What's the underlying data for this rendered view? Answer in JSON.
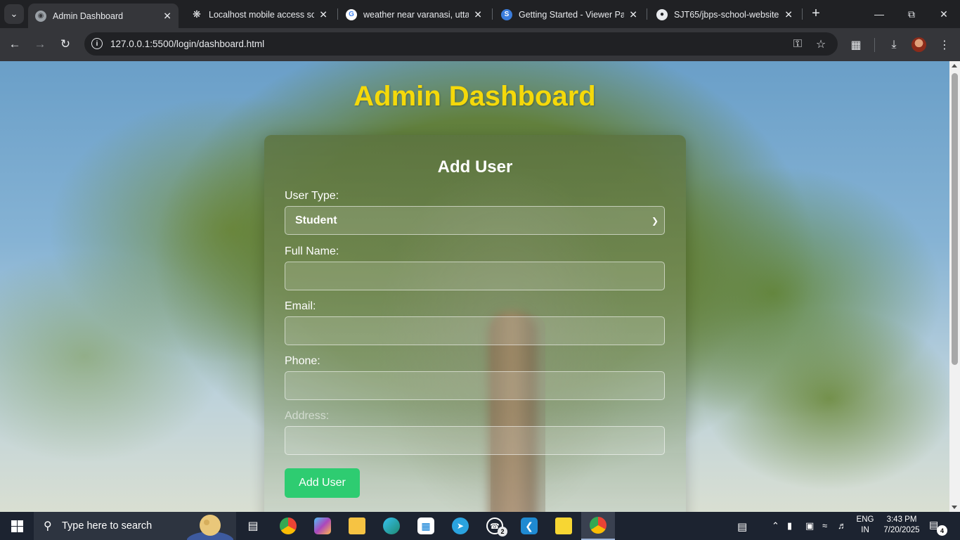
{
  "browser": {
    "tabs": [
      {
        "title": "Admin Dashboard",
        "active": true,
        "icon": "globe-icon"
      },
      {
        "title": "Localhost mobile access solu",
        "active": false,
        "icon": "chatgpt-icon"
      },
      {
        "title": "weather near varanasi, uttar",
        "active": false,
        "icon": "google-icon"
      },
      {
        "title": "Getting Started - Viewer Pag",
        "active": false,
        "icon": "s-icon"
      },
      {
        "title": "SJT65/jbps-school-website-",
        "active": false,
        "icon": "github-icon"
      }
    ],
    "url": "127.0.0.1:5500/login/dashboard.html"
  },
  "page": {
    "heading": "Admin Dashboard",
    "form": {
      "title": "Add User",
      "user_type_label": "User Type:",
      "user_type_value": "Student",
      "full_name_label": "Full Name:",
      "full_name_value": "",
      "email_label": "Email:",
      "email_value": "",
      "phone_label": "Phone:",
      "phone_value": "",
      "address_label": "Address:",
      "address_value": "",
      "submit_label": "Add User"
    },
    "colors": {
      "heading": "#f5d90a",
      "submit": "#2ecc71"
    }
  },
  "taskbar": {
    "search_placeholder": "Type here to search",
    "whatsapp_badge": "2",
    "language": "ENG",
    "region": "IN",
    "time": "3:43 PM",
    "date": "7/20/2025",
    "notification_count": "4"
  }
}
